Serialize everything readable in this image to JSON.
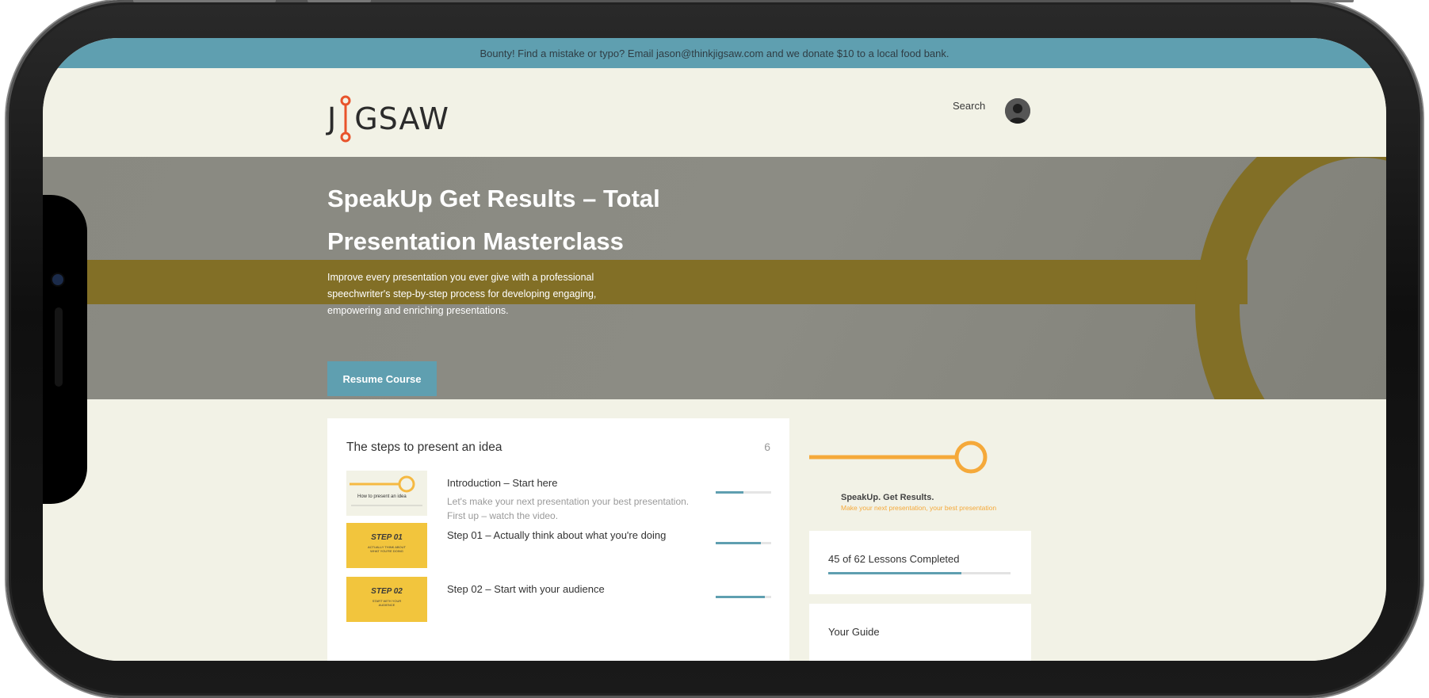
{
  "banner": {
    "text": "Bounty! Find a mistake or typo? Email jason@thinkjigsaw.com and we donate $10 to a local food bank."
  },
  "header": {
    "logo_left": "J",
    "logo_right": "GSAW",
    "search_label": "Search"
  },
  "hero": {
    "title_line1": "SpeakUp Get Results – Total",
    "title_line2": "Presentation Masterclass",
    "description": "Improve every presentation you ever give with a professional speechwriter's step-by-step process for developing engaging, empowering and enriching presentations.",
    "resume_label": "Resume Course"
  },
  "course_card": {
    "title": "The steps to present an idea",
    "count": "6",
    "lessons": [
      {
        "thumb_text": "How to present an idea",
        "title": "Introduction – Start here",
        "description": "Let's make your next presentation your best presentation. First up – watch the video.",
        "progress": 0.5
      },
      {
        "thumb_text": "STEP 01",
        "thumb_sub": "ACTUALLY THINK ABOUT WHAT YOU'RE DOING",
        "title": "Step 01 – Actually think about what you're doing",
        "description": "",
        "progress": 0.82
      },
      {
        "thumb_text": "STEP 02",
        "thumb_sub": "START WITH YOUR AUDIENCE",
        "title": "Step 02 – Start with your audience",
        "description": "",
        "progress": 0.88
      }
    ]
  },
  "sidebar": {
    "brand_title": "SpeakUp. Get Results.",
    "brand_tagline": "Make your next presentation, your best presentation",
    "lessons_completed": "45 of 62 Lessons Completed",
    "overall_progress": 0.73,
    "guide_title": "Your Guide"
  },
  "colors": {
    "teal": "#5f9fb0",
    "mustard": "#826f26",
    "orange": "#f5a93a",
    "cream": "#f2f2e6"
  }
}
